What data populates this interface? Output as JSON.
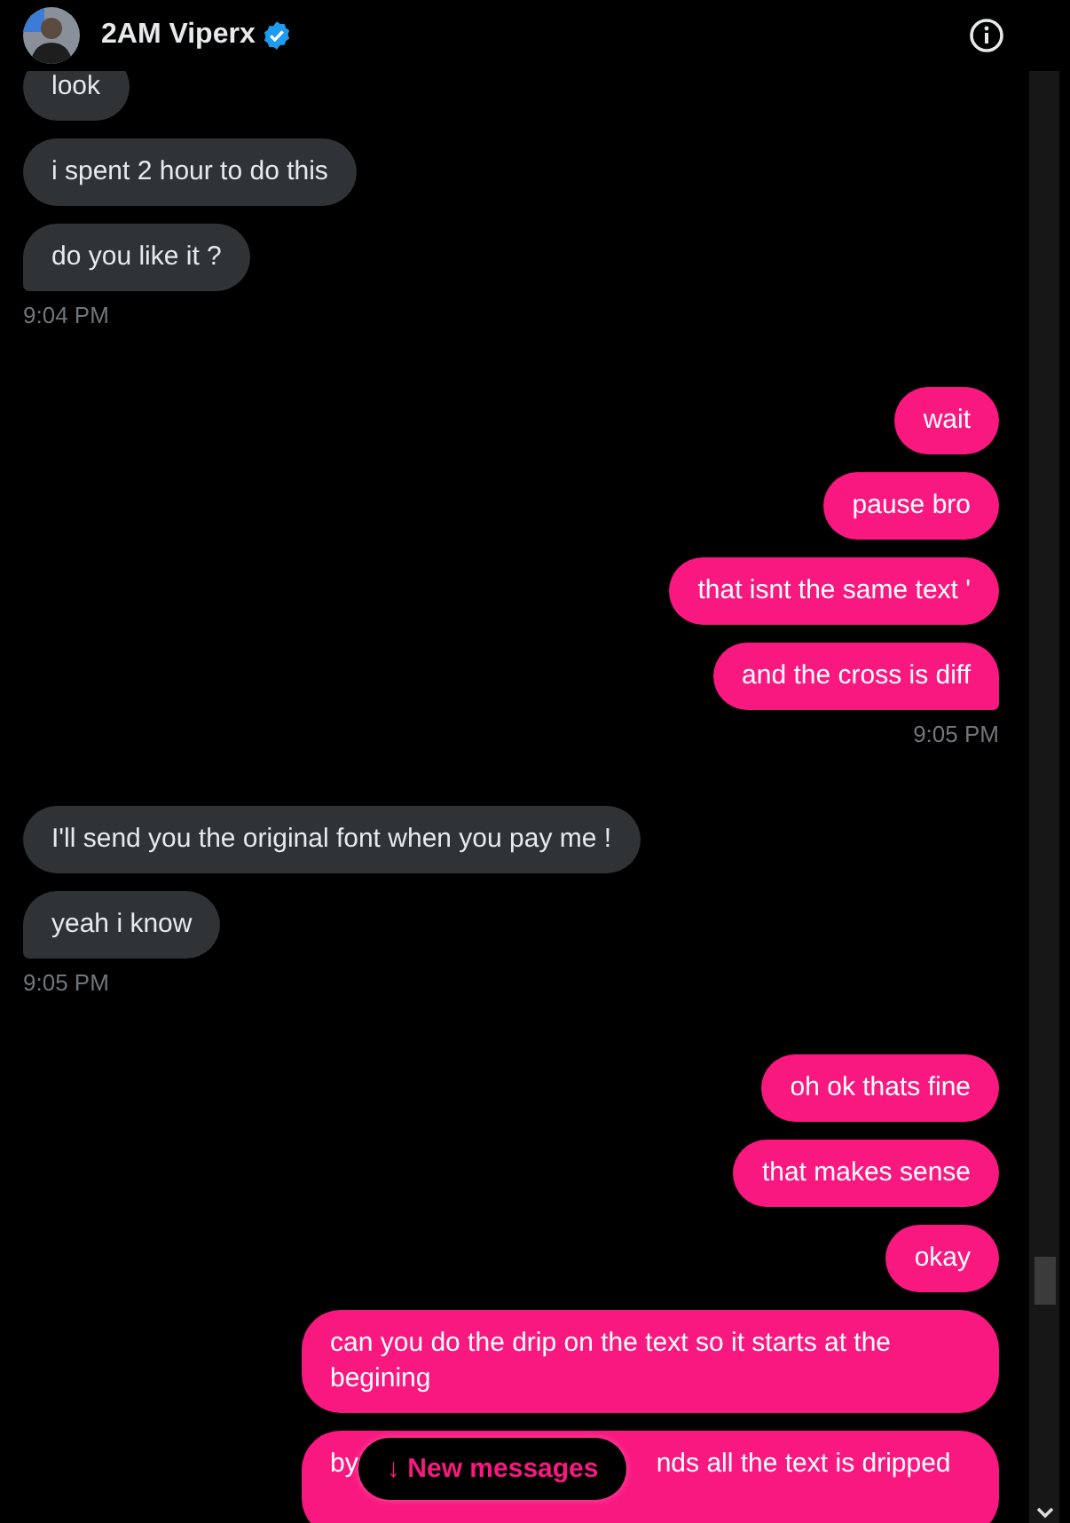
{
  "header": {
    "name": "2AM Viperx",
    "verified": true
  },
  "messages": [
    {
      "kind": "message",
      "sent": false,
      "text": "look"
    },
    {
      "kind": "message",
      "sent": false,
      "text": "i spent 2 hour to do this"
    },
    {
      "kind": "message",
      "sent": false,
      "text": "do you like it ?"
    },
    {
      "kind": "time",
      "sent": false,
      "text": "9:04 PM"
    },
    {
      "kind": "message",
      "sent": true,
      "text": "wait"
    },
    {
      "kind": "message",
      "sent": true,
      "text": "pause bro"
    },
    {
      "kind": "message",
      "sent": true,
      "text": "that isnt the same text '"
    },
    {
      "kind": "message",
      "sent": true,
      "text": "and the cross is diff"
    },
    {
      "kind": "time",
      "sent": true,
      "text": "9:05 PM"
    },
    {
      "kind": "message",
      "sent": false,
      "text": "I'll send you the original font when you pay me !"
    },
    {
      "kind": "message",
      "sent": false,
      "text": "yeah i know"
    },
    {
      "kind": "time",
      "sent": false,
      "text": "9:05 PM"
    },
    {
      "kind": "message",
      "sent": true,
      "text": "oh ok thats fine"
    },
    {
      "kind": "message",
      "sent": true,
      "text": "that makes sense"
    },
    {
      "kind": "message",
      "sent": true,
      "text": "okay"
    },
    {
      "kind": "message",
      "sent": true,
      "text": "can you do the drip on the text so it starts at the begining"
    },
    {
      "kind": "covered",
      "sent": true,
      "parts": [
        "by",
        "nds all the text is dripped"
      ]
    }
  ],
  "new_messages_button": "↓ New messages"
}
